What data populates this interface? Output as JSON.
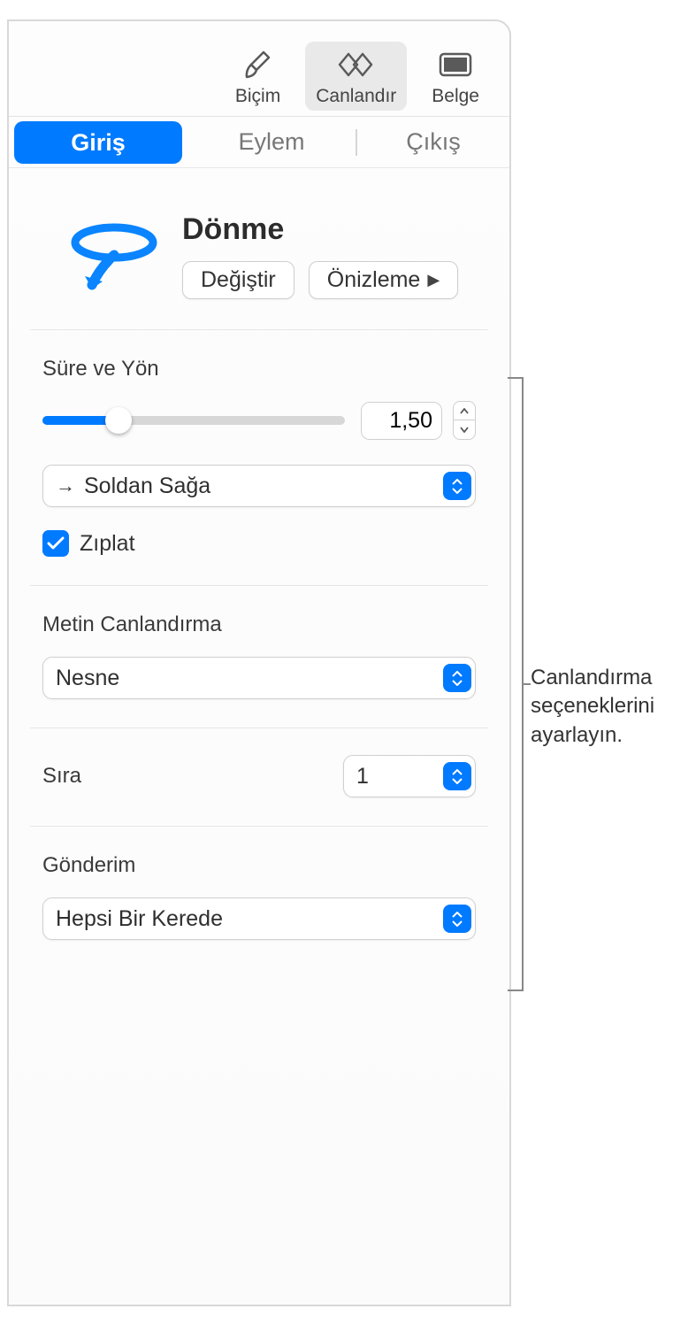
{
  "toolbar": {
    "format": "Biçim",
    "animate": "Canlandır",
    "document": "Belge"
  },
  "tabs": {
    "in": "Giriş",
    "action": "Eylem",
    "out": "Çıkış"
  },
  "effect": {
    "title": "Dönme",
    "change": "Değiştir",
    "preview": "Önizleme"
  },
  "duration": {
    "label": "Süre ve Yön",
    "value": "1,50",
    "direction": "Soldan Sağa",
    "bounce": "Zıplat"
  },
  "textAnim": {
    "label": "Metin Canlandırma",
    "value": "Nesne"
  },
  "order": {
    "label": "Sıra",
    "value": "1"
  },
  "delivery": {
    "label": "Gönderim",
    "value": "Hepsi Bir Kerede"
  },
  "callout": "Canlandırma seçeneklerini ayarlayın."
}
